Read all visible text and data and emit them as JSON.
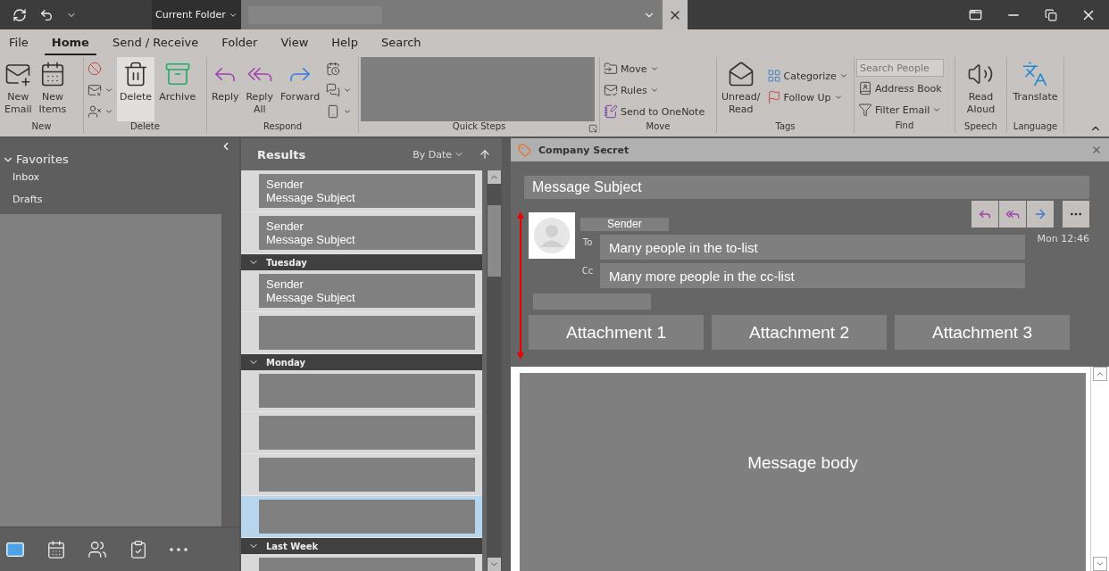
{
  "title_bar": {
    "scope": "Current Folder"
  },
  "menu_tabs": [
    {
      "label": "File",
      "selected": false
    },
    {
      "label": "Home",
      "selected": true
    },
    {
      "label": "Send / Receive",
      "selected": false
    },
    {
      "label": "Folder",
      "selected": false
    },
    {
      "label": "View",
      "selected": false
    },
    {
      "label": "Help",
      "selected": false
    },
    {
      "label": "Search",
      "selected": false
    }
  ],
  "ribbon": {
    "new": {
      "label": "New",
      "buttons": [
        {
          "lines": [
            "New",
            "Email"
          ],
          "highlighted": false
        },
        {
          "lines": [
            "New",
            "Items"
          ],
          "highlighted": false
        }
      ]
    },
    "delete": {
      "label": "Delete",
      "buttons": [
        {
          "lines": [
            "Delete"
          ],
          "highlighted": true
        },
        {
          "lines": [
            "Archive"
          ],
          "highlighted": false
        }
      ]
    },
    "respond": {
      "label": "Respond",
      "buttons": [
        {
          "lines": [
            "Reply"
          ],
          "highlighted": false
        },
        {
          "lines": [
            "Reply",
            "All"
          ],
          "highlighted": false
        },
        {
          "lines": [
            "Forward"
          ],
          "highlighted": false
        }
      ]
    },
    "quick_steps": {
      "label": "Quick Steps"
    },
    "move": {
      "label": "Move",
      "commands": [
        "Move",
        "Rules",
        "Send to OneNote"
      ]
    },
    "tags": {
      "label": "Tags",
      "buttons": [
        {
          "lines": [
            "Unread/",
            "Read"
          ],
          "highlighted": false
        }
      ],
      "commands": [
        "Categorize",
        "Follow Up"
      ]
    },
    "find": {
      "label": "Find",
      "search": {
        "placeholder": "Search People"
      },
      "commands": [
        "Address Book",
        "Filter Email"
      ]
    },
    "speech": {
      "label": "Speech",
      "buttons": [
        {
          "lines": [
            "Read",
            "Aloud"
          ],
          "highlighted": false
        }
      ]
    },
    "language": {
      "label": "Language",
      "buttons": [
        {
          "lines": [
            "Translate"
          ],
          "highlighted": false
        }
      ]
    }
  },
  "nav": {
    "favorites": {
      "label": "Favorites",
      "expanded": true,
      "items": [
        {
          "label": "Inbox"
        },
        {
          "label": "Drafts"
        }
      ]
    },
    "modules": [
      {
        "selected": true
      },
      {
        "selected": false
      },
      {
        "selected": false
      },
      {
        "selected": false
      },
      {
        "selected": false
      }
    ]
  },
  "message_list": {
    "title": "Results",
    "sort": "By Date",
    "groups": [
      {
        "items": [
          {
            "sender": "Sender",
            "subject": "Message Subject",
            "selected": false
          },
          {
            "sender": "Sender",
            "subject": "Message Subject",
            "selected": false
          }
        ]
      },
      {
        "label": "Tuesday",
        "expanded": true,
        "items": [
          {
            "sender": "Sender",
            "subject": "Message Subject",
            "selected": false
          },
          {
            "selected": false
          }
        ]
      },
      {
        "label": "Monday",
        "expanded": true,
        "items": [
          {
            "selected": false
          },
          {
            "selected": false
          },
          {
            "selected": false
          },
          {
            "selected": true
          }
        ]
      },
      {
        "label": "Last Week",
        "expanded": true,
        "items": [
          {
            "selected": false
          }
        ]
      }
    ]
  },
  "reading_pane": {
    "category": "Company Secret",
    "subject": "Message Subject",
    "sender": "Sender",
    "to_label": "To",
    "to": "Many people in the to-list",
    "cc_label": "Cc",
    "cc": "Many more people in the cc-list",
    "time": "Mon 12:46",
    "attachments": [
      "Attachment 1",
      "Attachment 2",
      "Attachment 3"
    ],
    "body": "Message body"
  }
}
